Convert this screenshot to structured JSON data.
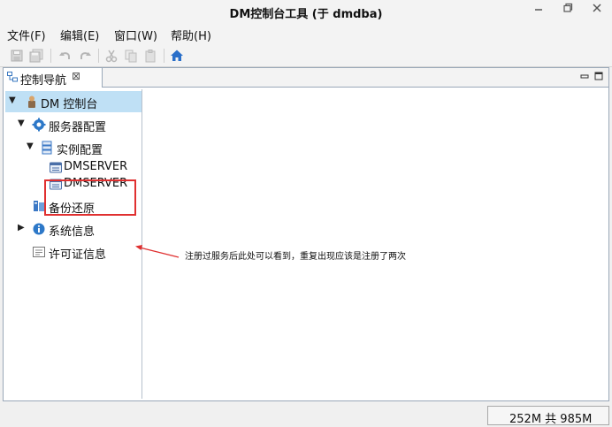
{
  "window": {
    "title": "DM控制台工具 (于 dmdba)"
  },
  "menu": [
    {
      "label": "文件(F)"
    },
    {
      "label": "编辑(E)"
    },
    {
      "label": "窗口(W)"
    },
    {
      "label": "帮助(H)"
    }
  ],
  "toolbar": {
    "buttons": [
      "save-icon",
      "save-all-icon",
      "undo-icon",
      "redo-icon",
      "cut-icon",
      "copy-icon",
      "paste-icon",
      "home-icon"
    ],
    "home_color": "#2a6fc9"
  },
  "panel": {
    "tab_label": "控制导航",
    "close_symbol": "⊠"
  },
  "tree": {
    "root": "DM 控制台",
    "server_config": "服务器配置",
    "instance_config": "实例配置",
    "instances": [
      "DMSERVER",
      "DMSERVER"
    ],
    "backup": "备份还原",
    "system_info": "系统信息",
    "license_info": "许可证信息",
    "selection_color": "#bfe0f5"
  },
  "annotation": {
    "text": "注册过服务后此处可以看到，重复出现应该是注册了两次",
    "color": "#e03030"
  },
  "status": {
    "memory": "252M 共 985M"
  }
}
